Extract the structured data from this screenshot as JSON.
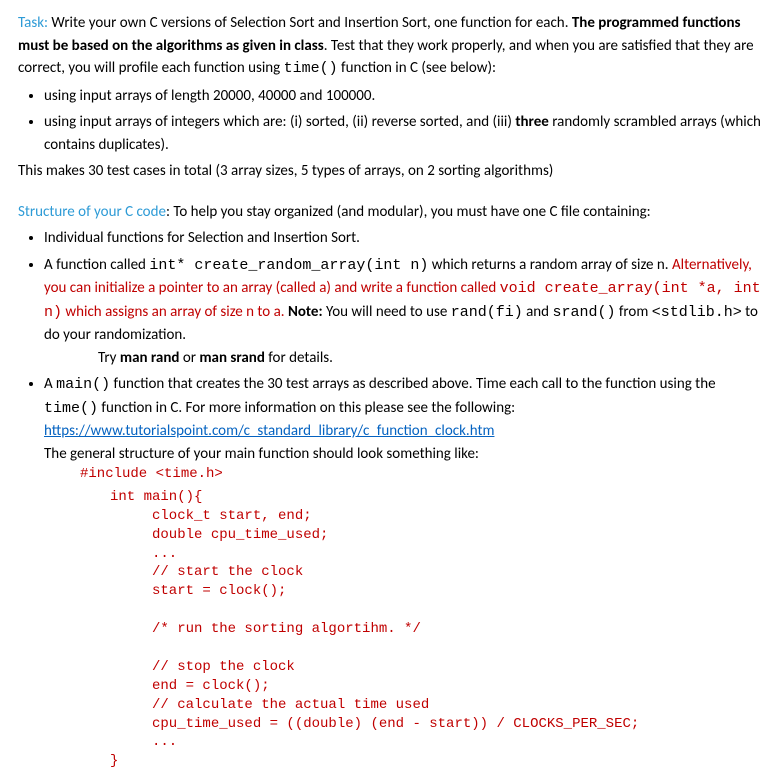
{
  "task": {
    "label": "Task:",
    "intro_a": " Write your own C versions of Selection Sort and Insertion Sort, one function for each. ",
    "intro_bold": "The programmed functions must be based on the algorithms as given in class",
    "intro_b": ". Test that they work properly, and when you are satisfied that they are correct, you will profile each function using ",
    "intro_code": "time()",
    "intro_c": " function in C (see below):",
    "bullets": {
      "b1": "using input arrays of length 20000, 40000 and 100000.",
      "b2_a": "using input arrays of integers which are: (i) sorted, (ii) reverse sorted, and (iii) ",
      "b2_bold": "three",
      "b2_b": " randomly scrambled arrays (which contains duplicates)."
    },
    "closing": "This makes 30 test cases in total (3 array sizes, 5 types of arrays, on 2 sorting algorithms)"
  },
  "structure": {
    "label": "Structure of your C code",
    "intro": ": To help you stay organized (and modular), you must have one C file containing:",
    "b1": "Individual functions for Selection and Insertion Sort.",
    "b2": {
      "a": "A function called ",
      "code1": "int* create_random_array(int n)",
      "b": " which returns a random array of size n. ",
      "red_a": "Alternatively, you can initialize a pointer to an array (called a) and write a function called ",
      "red_code": "void create_array(int *a, int n)",
      "red_b": "  which assigns an array of size n to a. ",
      "note_bold": "Note:",
      "c": " You will need to use ",
      "code2": "rand(fi)",
      "d": " and ",
      "code3": "srand()",
      "e": " from ",
      "code4": "<stdlib.h>",
      "f": " to do your randomization.",
      "try_a": "Try ",
      "try_b1": "man  rand",
      "try_b": " or ",
      "try_b2": "man  srand",
      "try_c": " for details."
    },
    "b3": {
      "a": "A ",
      "code1": "main()",
      "b": " function that creates the 30 test arrays as described above. Time each call to the function using the ",
      "code2": "time()",
      "c": " function in C. For more information on this please see the following:",
      "link": "https://www.tutorialspoint.com/c_standard_library/c_function_clock.htm",
      "d": "The general structure of your main function should look something like:"
    }
  },
  "code": {
    "include": "#include <time.h>",
    "body": "int main(){\n     clock_t start, end;\n     double cpu_time_used;\n     ...\n     // start the clock\n     start = clock();\n\n     /* run the sorting algortihm. */\n\n     // stop the clock\n     end = clock();\n     // calculate the actual time used\n     cpu_time_used = ((double) (end - start)) / CLOCKS_PER_SEC;\n     ...\n}"
  }
}
